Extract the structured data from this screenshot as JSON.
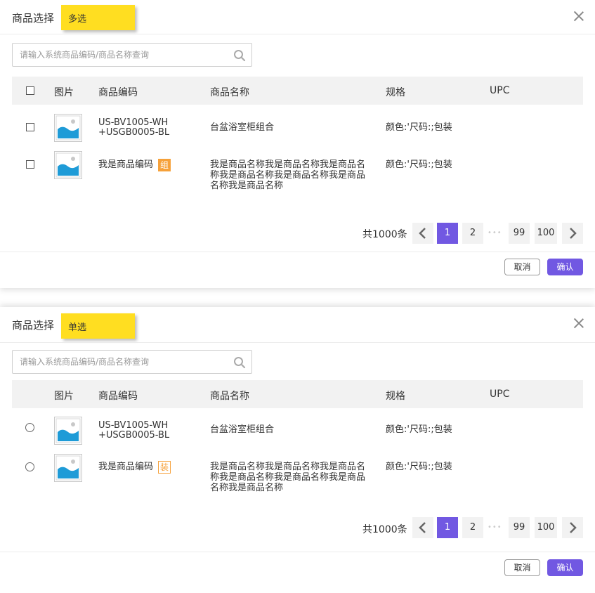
{
  "dialogs": [
    {
      "title": "商品选择",
      "note": "多选",
      "search_placeholder": "请输入系统商品编码/商品名称查询",
      "columns": {
        "image": "图片",
        "code": "商品编码",
        "name": "商品名称",
        "spec": "规格",
        "upc": "UPC"
      },
      "rows": [
        {
          "code_line1": "US-BV1005-WH",
          "code_line2": "+USGB0005-BL",
          "badge": "",
          "name_l1": "台盆浴室柜组合",
          "name_l2": "",
          "name_l3": "",
          "spec": "颜色:'尺码:;包装"
        },
        {
          "code_line1": "我是商品编码",
          "code_line2": "",
          "badge": "组",
          "name_l1": "我是商品名称我是商品名称我是商品名",
          "name_l2": "称我是商品名称我是商品名称我是商品",
          "name_l3": "名称我是商品名称",
          "spec": "颜色:'尺码:;包装"
        }
      ],
      "pagination": {
        "total": "共1000条",
        "pages": [
          "1",
          "2",
          "99",
          "100"
        ],
        "dots": "•••"
      },
      "buttons": {
        "cancel": "取消",
        "confirm": "确认"
      }
    },
    {
      "title": "商品选择",
      "note": "单选",
      "search_placeholder": "请输入系统商品编码/商品名称查询",
      "columns": {
        "image": "图片",
        "code": "商品编码",
        "name": "商品名称",
        "spec": "规格",
        "upc": "UPC"
      },
      "rows": [
        {
          "code_line1": "US-BV1005-WH",
          "code_line2": "+USGB0005-BL",
          "badge": "",
          "name_l1": "台盆浴室柜组合",
          "name_l2": "",
          "name_l3": "",
          "spec": "颜色:'尺码:;包装"
        },
        {
          "code_line1": "我是商品编码",
          "code_line2": "",
          "badge": "装",
          "name_l1": "我是商品名称我是商品名称我是商品名",
          "name_l2": "称我是商品名称我是商品名称我是商品",
          "name_l3": "名称我是商品名称",
          "spec": "颜色:'尺码:;包装"
        }
      ],
      "pagination": {
        "total": "共1000条",
        "pages": [
          "1",
          "2",
          "99",
          "100"
        ],
        "dots": "•••"
      },
      "buttons": {
        "cancel": "取消",
        "confirm": "确认"
      }
    }
  ],
  "colors": {
    "accent": "#7158e2",
    "badge": "#f6a13a",
    "note": "#ffde21",
    "header_bg": "#f2f2f2",
    "image_blue": "#1e9bd7"
  }
}
